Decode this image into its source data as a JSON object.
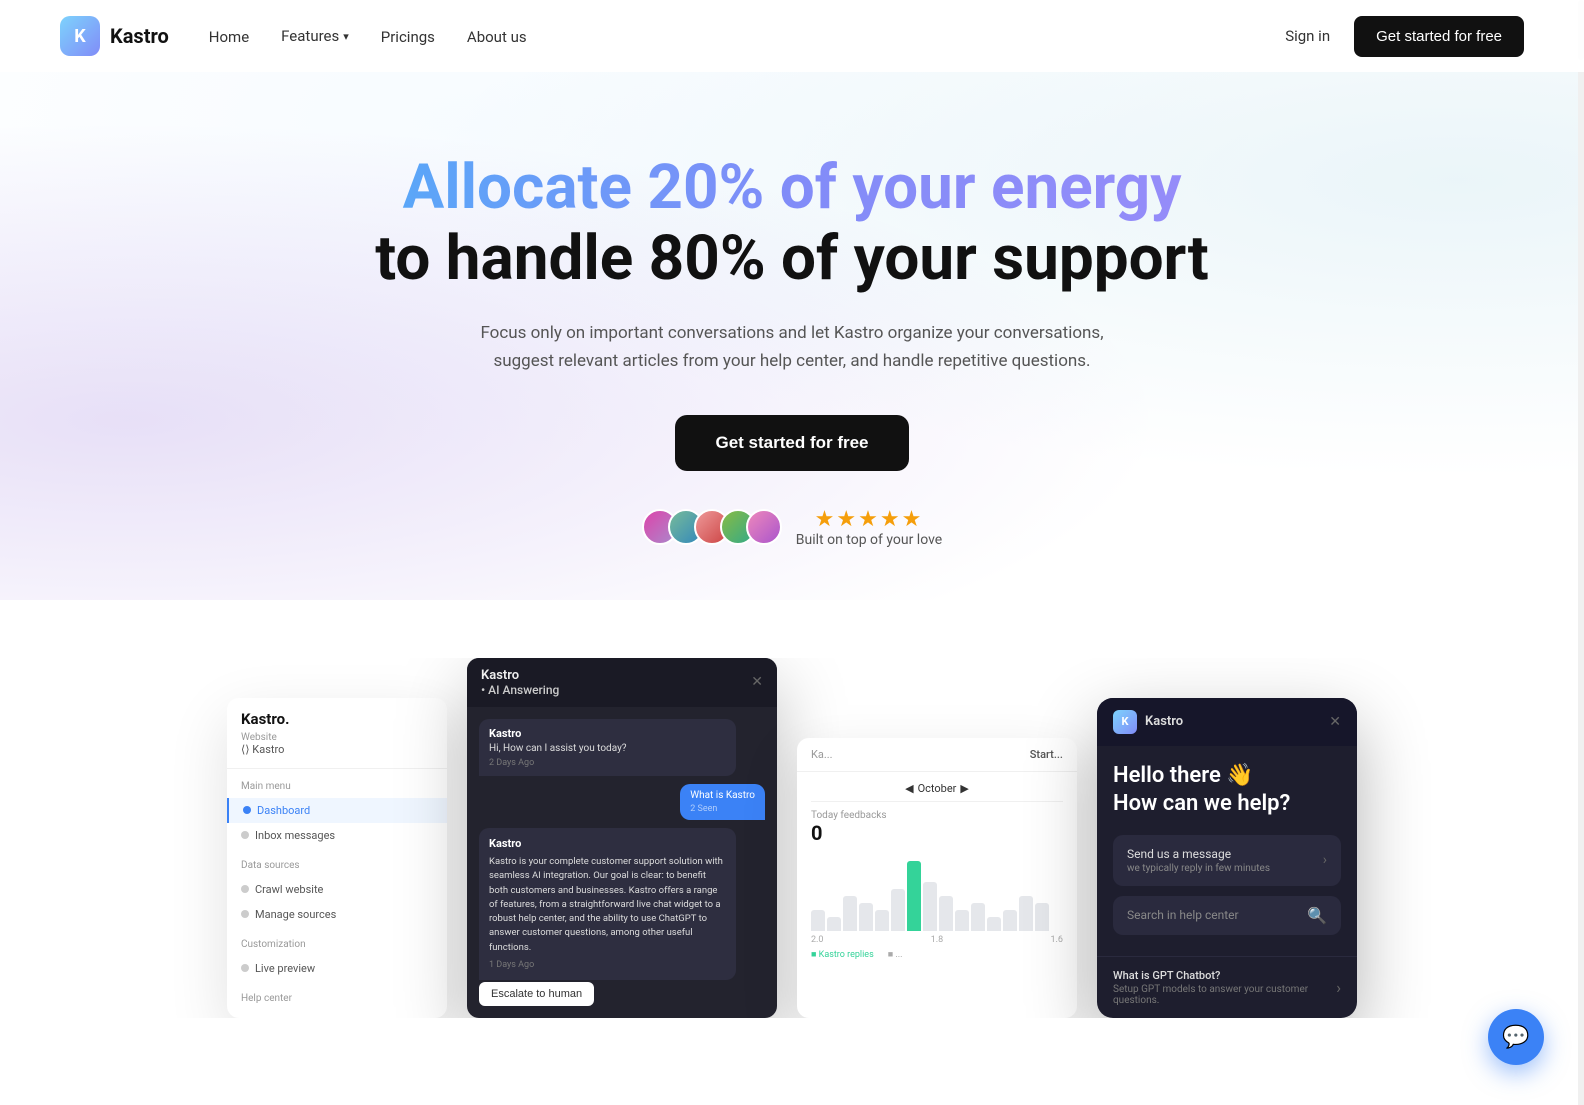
{
  "nav": {
    "logo_letter": "K",
    "logo_name": "Kastro",
    "links": [
      {
        "label": "Home",
        "has_dropdown": false
      },
      {
        "label": "Features",
        "has_dropdown": true
      },
      {
        "label": "Pricings",
        "has_dropdown": false
      },
      {
        "label": "About us",
        "has_dropdown": false
      }
    ],
    "sign_in": "Sign in",
    "get_started": "Get started for free"
  },
  "hero": {
    "headline_gradient": "Allocate 20% of your energy",
    "headline_dark": "to handle 80% of your support",
    "subtext": "Focus only on important conversations and let Kastro organize your conversations, suggest relevant articles from your help center, and handle repetitive questions.",
    "cta": "Get started for free",
    "stars": "★★★★★",
    "social_text": "Built on top of your love"
  },
  "sidebar": {
    "brand": "Kastro.",
    "website_label": "Website",
    "website_value": "⟨⟩ Kastro",
    "sections": [
      {
        "title": "Main menu",
        "items": [
          {
            "label": "Dashboard",
            "active": true,
            "icon": "dashboard"
          },
          {
            "label": "Inbox messages",
            "active": false,
            "icon": "inbox"
          }
        ]
      },
      {
        "title": "Data sources",
        "items": [
          {
            "label": "Crawl website",
            "active": false,
            "icon": "crawl"
          },
          {
            "label": "Manage sources",
            "active": false,
            "icon": "sources"
          }
        ]
      },
      {
        "title": "Customization",
        "items": [
          {
            "label": "Live preview",
            "active": false,
            "icon": "preview"
          }
        ]
      },
      {
        "title": "Help center",
        "items": [
          {
            "label": "Help center",
            "active": false,
            "icon": "help"
          }
        ]
      }
    ]
  },
  "chat": {
    "title": "• AI Answering",
    "brand": "Kastro",
    "greeting": "Hi, How can I assist you today?",
    "greeting_time": "2 Days Ago",
    "user_msg": "What is Kastro",
    "user_time": "2 Seen",
    "bot_response": "Kastro is your complete customer support solution with seamless AI integration. Our goal is clear: to benefit both customers and businesses. Kastro offers a range of features, from a straightforward live chat widget to a robust help center, and the ability to use ChatGPT to answer customer questions, among other useful functions.",
    "bot_time": "1 Days Ago",
    "escalate_btn": "Escalate to human"
  },
  "analytics": {
    "title": "Today feedbacks",
    "value": "0",
    "date": "October",
    "bars": [
      0.3,
      0.2,
      0.5,
      0.4,
      0.3,
      0.6,
      1.0,
      0.7,
      0.5,
      0.3,
      0.4,
      0.2,
      0.3,
      0.5,
      0.4
    ]
  },
  "widget": {
    "brand": "Kastro",
    "logo_letter": "K",
    "greeting": "Hello there 👋\nHow can we help?",
    "option1_title": "Send us a message",
    "option1_sub": "we typically reply in few minutes",
    "option2_title": "Search in help center",
    "faq_title": "What is GPT Chatbot?",
    "faq_sub": "Setup GPT models to answer your customer questions."
  },
  "chat_bubble": {
    "icon": "💬"
  }
}
